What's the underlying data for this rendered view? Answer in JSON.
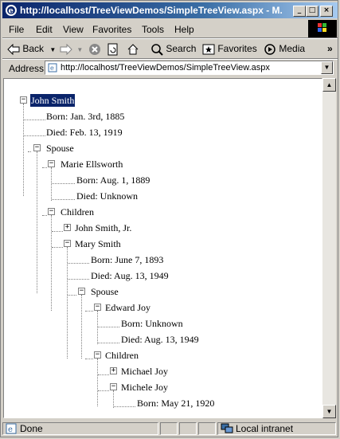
{
  "window": {
    "title": "http://localhost/TreeViewDemos/SimpleTreeView.aspx - M..."
  },
  "menu": [
    "File",
    "Edit",
    "View",
    "Favorites",
    "Tools",
    "Help"
  ],
  "toolbar": {
    "back": "Back",
    "search": "Search",
    "favorites": "Favorites",
    "media": "Media"
  },
  "address": {
    "label": "Address",
    "url": "http://localhost/TreeViewDemos/SimpleTreeView.aspx"
  },
  "tree": {
    "n0": "John Smith",
    "n1": "Born: Jan. 3rd, 1885",
    "n2": "Died: Feb. 13, 1919",
    "n3": "Spouse",
    "n4": "Marie Ellsworth",
    "n5": "Born: Aug. 1, 1889",
    "n6": "Died: Unknown",
    "n7": "Children",
    "n8": "John Smith, Jr.",
    "n9": "Mary Smith",
    "n10": "Born: June 7, 1893",
    "n11": "Died: Aug. 13, 1949",
    "n12": "Spouse",
    "n13": "Edward Joy",
    "n14": "Born: Unknown",
    "n15": "Died: Aug. 13, 1949",
    "n16": "Children",
    "n17": "Michael Joy",
    "n18": "Michele Joy",
    "n19": "Born: May 21, 1920"
  },
  "status": {
    "left": "Done",
    "zone": "Local intranet"
  }
}
